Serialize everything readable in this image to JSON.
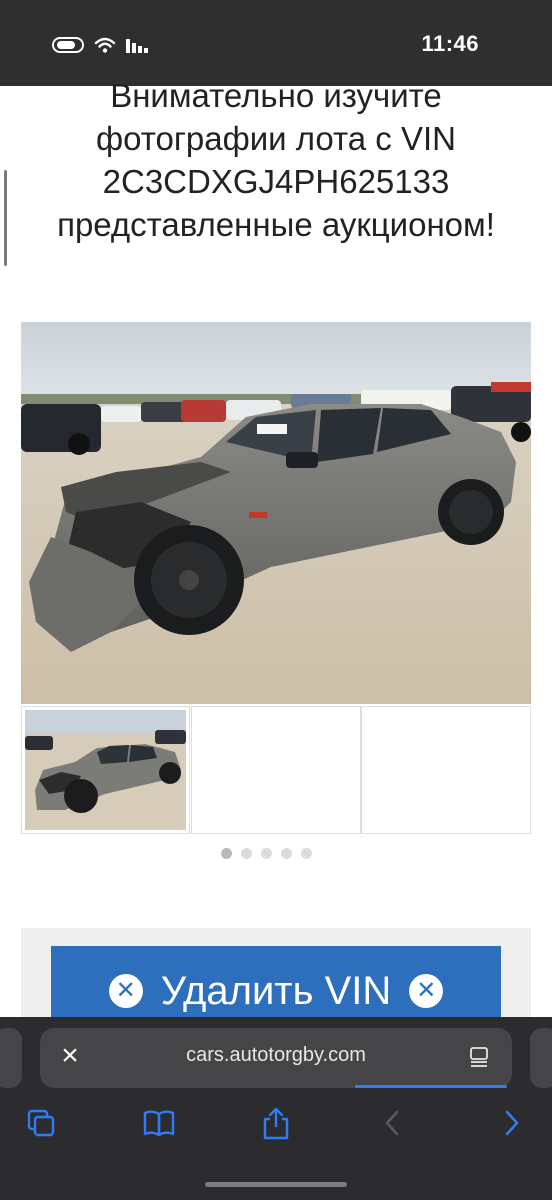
{
  "status_bar": {
    "time": "11:46",
    "icons": [
      "toggle-icon",
      "wifi-icon",
      "signal-icon"
    ]
  },
  "heading": {
    "line1": "Внимательно изучите",
    "line2": "фотографии лота с VIN",
    "line3": "2C3CDXGJ4PH625133",
    "line4": "представленные аукционом!"
  },
  "gallery": {
    "dots_total": 5,
    "active_dot": 1,
    "main_photo_desc": "grey sedan with damaged front on gravel lot"
  },
  "actions": {
    "delete_vin_label": "Удалить VIN",
    "delete_icon": "x-circle-icon"
  },
  "browser": {
    "url": "cars.autotorgby.com",
    "close_icon": "close-icon",
    "reader_icon": "reader-icon",
    "toolbar": [
      "tabs-icon",
      "bookmarks-icon",
      "share-icon",
      "back-icon",
      "forward-icon"
    ]
  },
  "colors": {
    "status_bar_bg": "#2f2f2f",
    "accent_blue": "#2d6fbd",
    "browser_bg": "#2c2c2e",
    "toolbar_blue": "#2f7cf6"
  }
}
